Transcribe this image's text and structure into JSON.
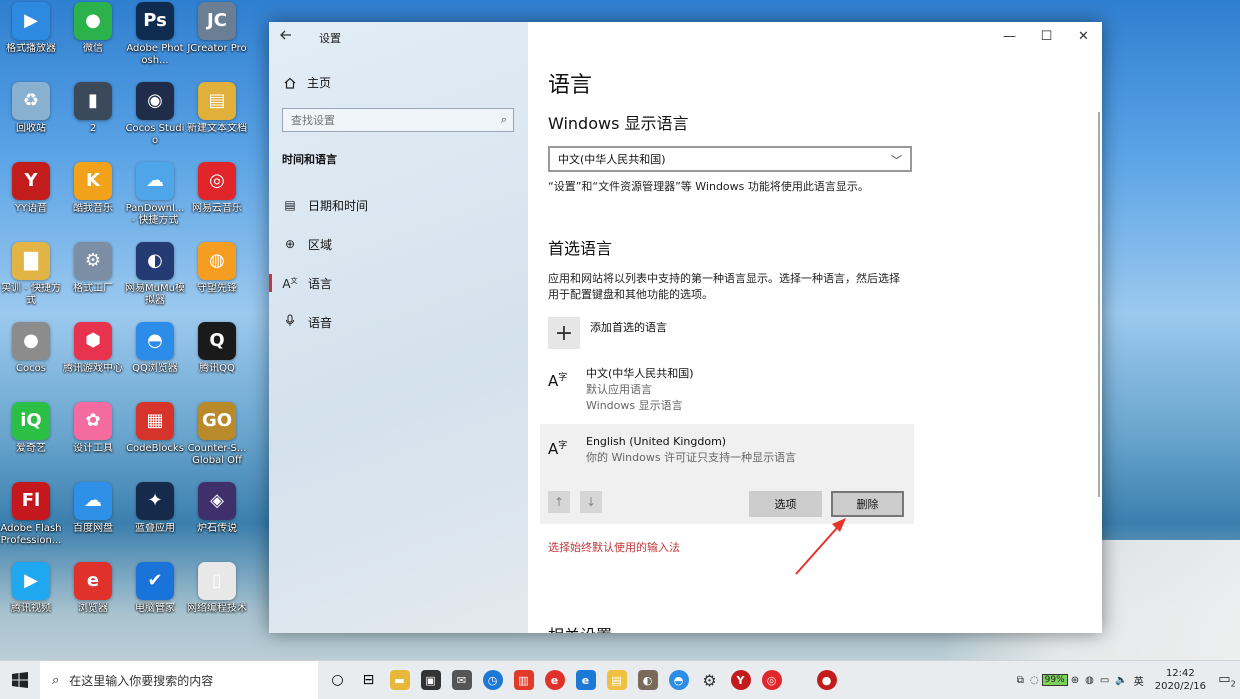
{
  "desktop": {
    "icons": [
      {
        "label": "格式播放器",
        "color": "#2d8ae0",
        "glyph": "▶"
      },
      {
        "label": "微信",
        "color": "#2bb24c",
        "glyph": "●"
      },
      {
        "label": "Adobe Photosh...",
        "color": "#0d2c4f",
        "glyph": "Ps"
      },
      {
        "label": "JCreator Pro",
        "color": "#6a7f94",
        "glyph": "JC"
      },
      {
        "label": "回收站",
        "color": "#8ab0cf",
        "glyph": "♻"
      },
      {
        "label": "2",
        "color": "#3a4a5a",
        "glyph": "▮"
      },
      {
        "label": "Cocos Studio",
        "color": "#1f2c4a",
        "glyph": "◉"
      },
      {
        "label": "新建文本文档",
        "color": "#e0b03a",
        "glyph": "▤"
      },
      {
        "label": "YY语音",
        "color": "#c21c1c",
        "glyph": "Y"
      },
      {
        "label": "酷我音乐",
        "color": "#f2a11b",
        "glyph": "K"
      },
      {
        "label": "PanDownl... - 快捷方式",
        "color": "#4ea6e8",
        "glyph": "☁"
      },
      {
        "label": "网易云音乐",
        "color": "#e0262b",
        "glyph": "◎"
      },
      {
        "label": "实训 - 快捷方式",
        "color": "#e2b446",
        "glyph": "▇"
      },
      {
        "label": "格式工厂",
        "color": "#7b8ea3",
        "glyph": "⚙"
      },
      {
        "label": "网易MuMu模拟器",
        "color": "#243a73",
        "glyph": "◐"
      },
      {
        "label": "守望先锋",
        "color": "#f59d20",
        "glyph": "◍"
      },
      {
        "label": "Cocos",
        "color": "#8c8c8c",
        "glyph": "●"
      },
      {
        "label": "腾讯游戏中心",
        "color": "#e8334f",
        "glyph": "⬢"
      },
      {
        "label": "QQ浏览器",
        "color": "#2b8de8",
        "glyph": "◓"
      },
      {
        "label": "腾讯QQ",
        "color": "#1a1a1a",
        "glyph": "Q"
      },
      {
        "label": "爱奇艺",
        "color": "#2bbf45",
        "glyph": "iQ"
      },
      {
        "label": "设计工具",
        "color": "#f46ba0",
        "glyph": "✿"
      },
      {
        "label": "CodeBlocks",
        "color": "#d6332b",
        "glyph": "▦"
      },
      {
        "label": "Counter-S... Global Offe...",
        "color": "#b88a2a",
        "glyph": "GO"
      },
      {
        "label": "Adobe Flash Profession...",
        "color": "#c4171e",
        "glyph": "Fl"
      },
      {
        "label": "百度网盘",
        "color": "#2e90e6",
        "glyph": "☁"
      },
      {
        "label": "蓝叠应用",
        "color": "#162a4c",
        "glyph": "✦"
      },
      {
        "label": "炉石传说",
        "color": "#3f2f6b",
        "glyph": "◈"
      },
      {
        "label": "腾讯视频",
        "color": "#1fa7f0",
        "glyph": "▶"
      },
      {
        "label": "浏览器",
        "color": "#e0312b",
        "glyph": "e"
      },
      {
        "label": "电脑管家",
        "color": "#1a73d9",
        "glyph": "✔"
      },
      {
        "label": "网络编程技术",
        "color": "#e8e8e8",
        "glyph": "▯"
      }
    ]
  },
  "window": {
    "title": "设置",
    "home_label": "主页",
    "search_placeholder": "查找设置",
    "section_title": "时间和语言",
    "nav": [
      {
        "label": "日期和时间",
        "icon": "calendar-icon",
        "glyph": "▤"
      },
      {
        "label": "区域",
        "icon": "globe-icon",
        "glyph": "⊕"
      },
      {
        "label": "语言",
        "icon": "language-icon",
        "glyph": "A"
      },
      {
        "label": "语音",
        "icon": "microphone-icon",
        "glyph": "🎙"
      }
    ],
    "content": {
      "title": "语言",
      "display_lang_heading": "Windows 显示语言",
      "display_lang_value": "中文(中华人民共和国)",
      "display_lang_note": "“设置”和“文件资源管理器”等 Windows 功能将使用此语言显示。",
      "preferred_heading": "首选语言",
      "preferred_note_1": "应用和网站将以列表中支持的第一种语言显示。选择一种语言，然后选择",
      "preferred_note_2": "用于配置键盘和其他功能的选项。",
      "add_language": "添加首选的语言",
      "languages": [
        {
          "name": "中文(中华人民共和国)",
          "sub1": "默认应用语言",
          "sub2": "Windows 显示语言"
        },
        {
          "name": "English (United Kingdom)",
          "sub1": "你的 Windows 许可证只支持一种显示语言",
          "sub2": ""
        }
      ],
      "options_button": "选项",
      "remove_button": "删除",
      "input_method_link": "选择始终默认使用的输入法",
      "related_heading": "相关设置"
    }
  },
  "taskbar": {
    "search_placeholder": "在这里输入你要搜索的内容",
    "battery": "99%",
    "time": "12:42",
    "date": "2020/2/16",
    "notification_count": "2"
  }
}
